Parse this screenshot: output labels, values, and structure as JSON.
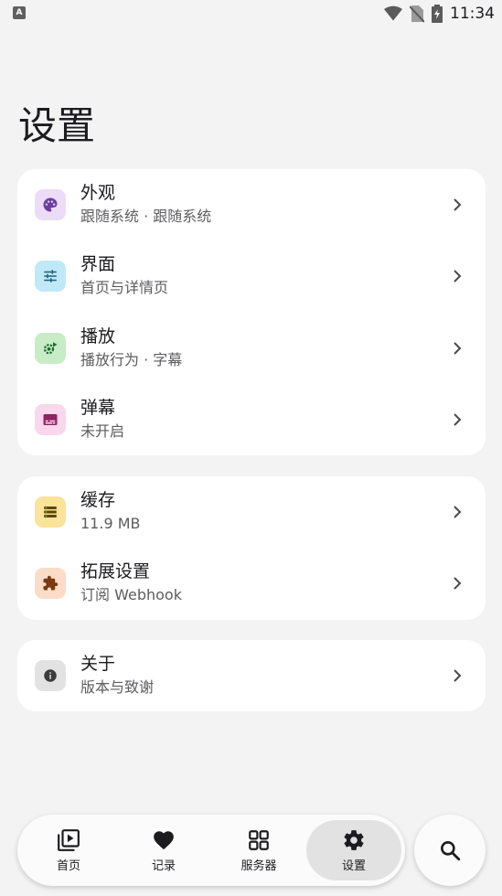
{
  "status_bar": {
    "left_badge": "A",
    "time": "11:34"
  },
  "page": {
    "title": "设置"
  },
  "groups": [
    {
      "items": [
        {
          "title": "外观",
          "subtitle": "跟随系统 · 跟随系统",
          "icon": "palette-icon",
          "icon_bg": "#ecdcf7",
          "icon_color": "#6b3fa0"
        },
        {
          "title": "界面",
          "subtitle": "首页与详情页",
          "icon": "tune-icon",
          "icon_bg": "#bfe9f7",
          "icon_color": "#1f6078"
        },
        {
          "title": "播放",
          "subtitle": "播放行为 · 字幕",
          "icon": "play-settings-icon",
          "icon_bg": "#c7ecc6",
          "icon_color": "#1f6a2a"
        },
        {
          "title": "弹幕",
          "subtitle": "未开启",
          "icon": "subtitles-icon",
          "icon_bg": "#f9d7ec",
          "icon_color": "#8e2464"
        }
      ]
    },
    {
      "items": [
        {
          "title": "缓存",
          "subtitle": "11.9 MB",
          "icon": "storage-icon",
          "icon_bg": "#fbe39a",
          "icon_color": "#5c4800"
        },
        {
          "title": "拓展设置",
          "subtitle": "订阅 Webhook",
          "icon": "extension-icon",
          "icon_bg": "#fbdcc8",
          "icon_color": "#7a3a14"
        }
      ]
    },
    {
      "items": [
        {
          "title": "关于",
          "subtitle": "版本与致谢",
          "icon": "info-icon",
          "icon_bg": "#e2e2e2",
          "icon_color": "#3c3c3c"
        }
      ]
    }
  ],
  "bottom_nav": {
    "items": [
      {
        "label": "首页",
        "icon": "video-library-icon",
        "active": false
      },
      {
        "label": "记录",
        "icon": "heart-icon",
        "active": false
      },
      {
        "label": "服务器",
        "icon": "grid-icon",
        "active": false
      },
      {
        "label": "设置",
        "icon": "gear-icon",
        "active": true
      }
    ],
    "search_icon": "search-icon"
  }
}
